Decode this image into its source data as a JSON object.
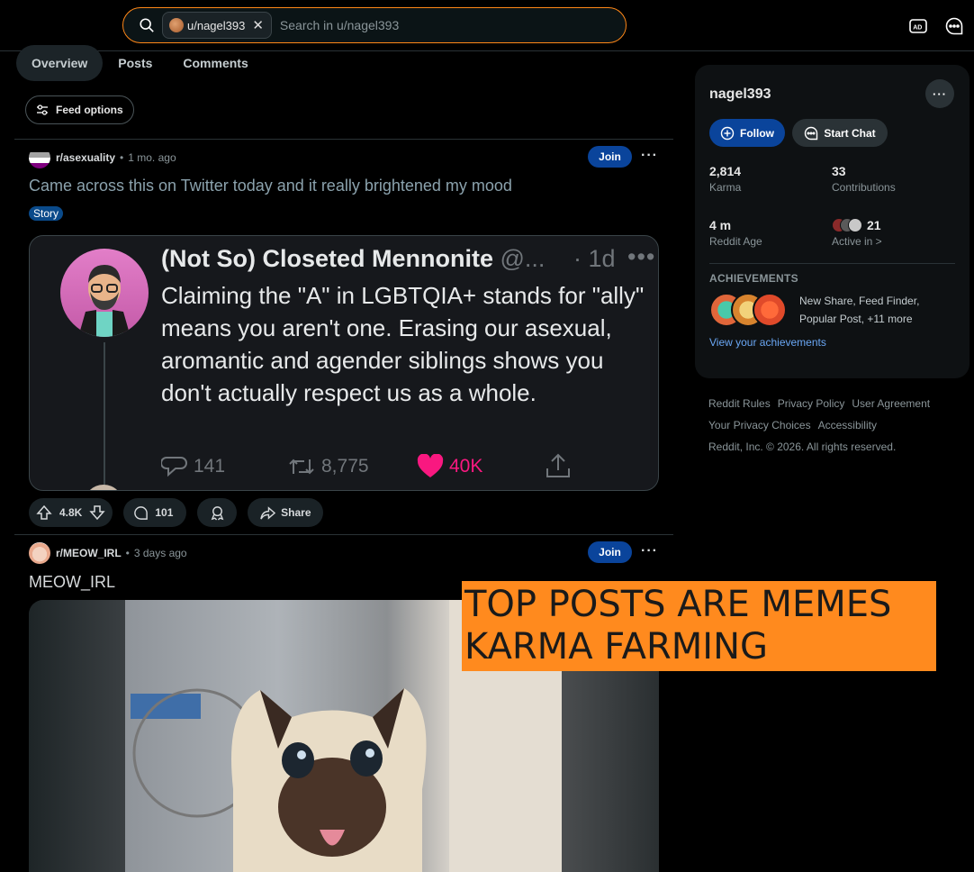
{
  "search": {
    "chip_label": "u/nagel393",
    "placeholder": "Search in u/nagel393"
  },
  "header_icons": [
    "advertise-icon",
    "chat-icon"
  ],
  "tabs": [
    {
      "label": "Overview",
      "active": true
    },
    {
      "label": "Posts",
      "active": false
    },
    {
      "label": "Comments",
      "active": false
    }
  ],
  "feed_options_label": "Feed options",
  "posts": [
    {
      "subreddit": "r/asexuality",
      "time": "1 mo. ago",
      "join_label": "Join",
      "title": "Came across this on Twitter today and it really brightened my mood",
      "flair": "Story",
      "tweet": {
        "name": "(Not So) Closeted Mennonite",
        "handle": "@...",
        "time": "· 1d",
        "text": "Claiming the \"A\" in LGBTQIA+ stands for \"ally\" means you aren't one. Erasing our asexual, aromantic and agender siblings shows you don't actually respect us as a whole.",
        "replies": "141",
        "retweets": "8,775",
        "likes": "40K"
      },
      "score": "4.8K",
      "comments": "101",
      "share_label": "Share"
    },
    {
      "subreddit": "r/MEOW_IRL",
      "time": "3 days ago",
      "join_label": "Join",
      "title": "MEOW_IRL"
    }
  ],
  "overlay_caption": {
    "line1": "TOP POSTS ARE MEMES",
    "line2": "KARMA FARMING"
  },
  "profile": {
    "username": "nagel393",
    "follow_label": "Follow",
    "chat_label": "Start Chat",
    "karma": "2,814",
    "karma_label": "Karma",
    "contributions": "33",
    "contributions_label": "Contributions",
    "reddit_age": "4 m",
    "reddit_age_label": "Reddit Age",
    "active_in": "21",
    "active_in_label": "Active in >",
    "achievements_heading": "ACHIEVEMENTS",
    "achievements_text": "New Share, Feed Finder, Popular Post, +11 more",
    "achievements_link": "View your achievements"
  },
  "footer": {
    "links": [
      "Reddit Rules",
      "Privacy Policy",
      "User Agreement",
      "Your Privacy Choices",
      "Accessibility"
    ],
    "copyright": "Reddit, Inc. © 2026. All rights reserved."
  },
  "colors": {
    "accent_blue": "#0a449b",
    "search_border": "#ff8717",
    "meme_bg": "#ff8a1e",
    "like_pink": "#f91880"
  }
}
